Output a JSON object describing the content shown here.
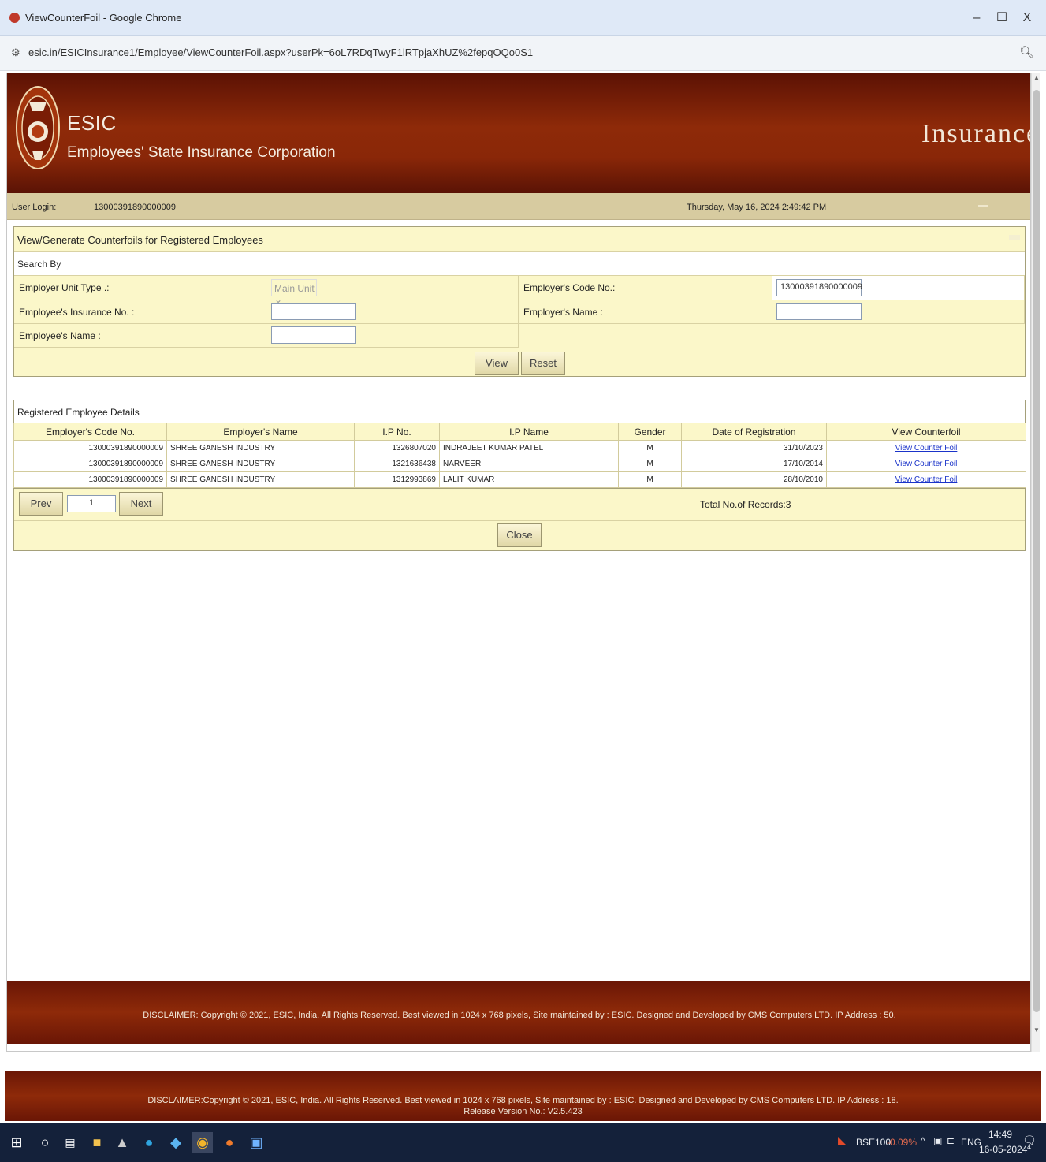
{
  "browser": {
    "window_title": "ViewCounterFoil - Google Chrome",
    "url": "esic.in/ESICInsurance1/Employee/ViewCounterFoil.aspx?userPk=6oL7RDqTwyF1lRTpjaXhUZ%2fepqOQo0S1",
    "minimize": "–",
    "maximize": "☐",
    "close": "X"
  },
  "header": {
    "brand": "ESIC",
    "org_name": "Employees' State Insurance Corporation",
    "section": "Insurance"
  },
  "login_bar": {
    "user_login_label": "User Login:",
    "user_login_value": "13000391890000009",
    "datetime": "Thursday, May 16, 2024 2:49:42 PM"
  },
  "search": {
    "panel_title": "View/Generate Counterfoils for Registered Employees",
    "search_by": "Search By",
    "employer_unit_type_label": "Employer Unit Type .:",
    "employer_unit_type_value": "Main Unit",
    "employers_code_label": "Employer's Code No.:",
    "employers_code_value": "13000391890000009",
    "insurance_no_label": "Employee's Insurance No. :",
    "insurance_no_value": "",
    "employers_name_label": "Employer's Name :",
    "employers_name_value": "",
    "employees_name_label": "Employee's Name :",
    "employees_name_value": "",
    "view_button": "View",
    "reset_button": "Reset"
  },
  "details": {
    "title": "Registered Employee Details",
    "columns": [
      "Employer's Code No.",
      "Employer's Name",
      "I.P No.",
      "I.P Name",
      "Gender",
      "Date of Registration",
      "View Counterfoil"
    ],
    "rows": [
      {
        "code": "13000391890000009",
        "employer": "SHREE GANESH INDUSTRY",
        "ip_no": "1326807020",
        "ip_name": "INDRAJEET KUMAR PATEL",
        "gender": "M",
        "date": "31/10/2023",
        "link": "View Counter Foil"
      },
      {
        "code": "13000391890000009",
        "employer": "SHREE GANESH INDUSTRY",
        "ip_no": "1321636438",
        "ip_name": "NARVEER",
        "gender": "M",
        "date": "17/10/2014",
        "link": "View Counter Foil"
      },
      {
        "code": "13000391890000009",
        "employer": "SHREE GANESH INDUSTRY",
        "ip_no": "1312993869",
        "ip_name": "LALIT KUMAR",
        "gender": "M",
        "date": "28/10/2010",
        "link": "View Counter Foil"
      }
    ],
    "prev_button": "Prev",
    "page_value": "1",
    "next_button": "Next",
    "total_records": "Total No.of Records:3",
    "close_button": "Close"
  },
  "footer_inner": "DISCLAIMER: Copyright © 2021, ESIC, India. All Rights Reserved. Best viewed in 1024 x 768 pixels, Site maintained by : ESIC. Designed and Developed by CMS Computers LTD. IP Address : 50.",
  "footer_outer": {
    "disclaimer": "DISCLAIMER:Copyright © 2021, ESIC, India. All Rights Reserved. Best viewed in 1024 x 768 pixels, Site maintained by : ESIC. Designed and Developed by CMS Computers LTD. IP Address : 18.",
    "release": "Release Version No.: V2.5.423"
  },
  "taskbar": {
    "ticker": "BSE100",
    "ticker_change": "-0.09%",
    "lang": "ENG",
    "time": "14:49",
    "date": "16-05-2024",
    "notif_count": "4"
  },
  "colors": {
    "header_brown": "#8e2a09",
    "panel_yellow": "#fbf7c9",
    "login_bar": "#d7cba0",
    "link_blue": "#1a33c9",
    "taskbar": "#14213a"
  }
}
